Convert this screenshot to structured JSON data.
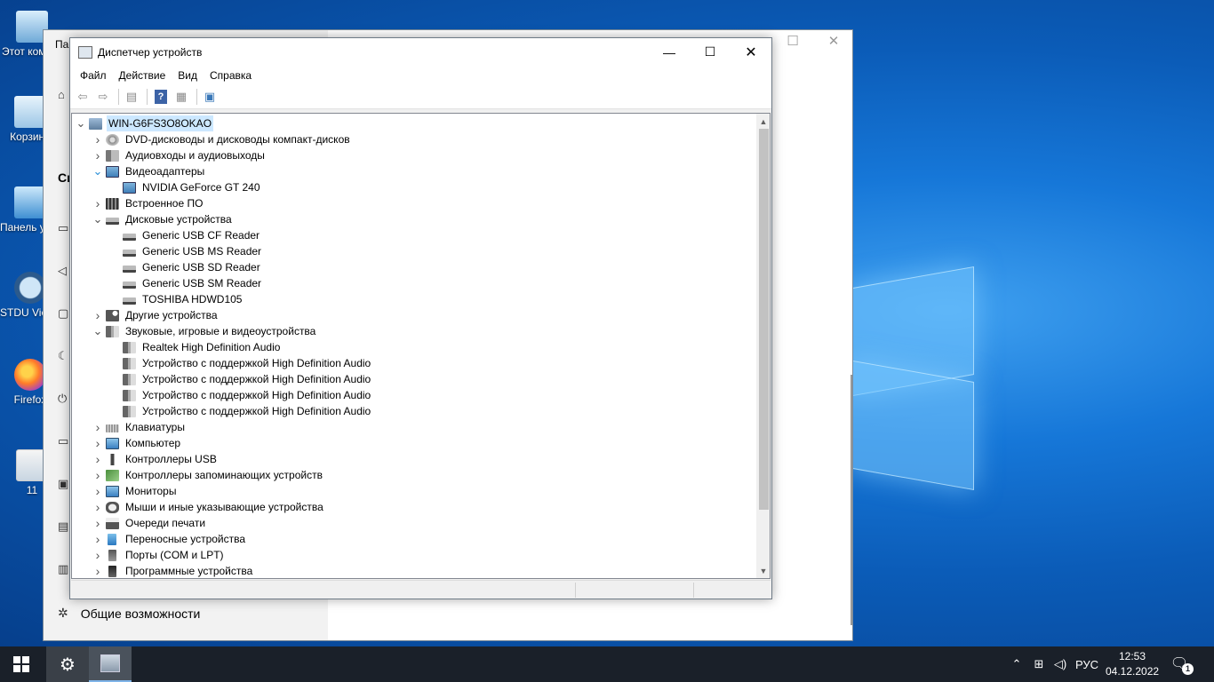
{
  "desktop": {
    "icons": [
      {
        "label": "Этот компьютер"
      },
      {
        "label": "Корзина"
      },
      {
        "label": "Панель управления"
      },
      {
        "label": "STDU Viewer"
      },
      {
        "label": "Firefox"
      },
      {
        "label": "11"
      }
    ]
  },
  "settings_window": {
    "title_fragment": "Па",
    "section_fragment": "Си",
    "accessibility_label": "Общие возможности"
  },
  "device_manager": {
    "title": "Диспетчер устройств",
    "menu": [
      "Файл",
      "Действие",
      "Вид",
      "Справка"
    ],
    "toolbar": [
      "back-icon",
      "forward-icon",
      "properties-view-icon",
      "help-icon",
      "action-pane-icon",
      "scan-hardware-icon"
    ],
    "tree": [
      {
        "level": 0,
        "label": "WIN-G6FS3O8OKAO",
        "expand": "open",
        "icon": "computer-icon"
      },
      {
        "level": 1,
        "label": "DVD-дисководы и дисководы компакт-дисков",
        "expand": "closed",
        "icon": "dvd-icon"
      },
      {
        "level": 1,
        "label": "Аудиовходы и аудиовыходы",
        "expand": "closed",
        "icon": "audio-io-icon"
      },
      {
        "level": 1,
        "label": "Видеоадаптеры",
        "expand": "open-hover",
        "icon": "video-adapter-icon"
      },
      {
        "level": 2,
        "label": "NVIDIA GeForce GT 240",
        "expand": "none",
        "icon": "video-adapter-icon"
      },
      {
        "level": 1,
        "label": "Встроенное ПО",
        "expand": "closed",
        "icon": "firmware-icon"
      },
      {
        "level": 1,
        "label": "Дисковые устройства",
        "expand": "open",
        "icon": "disk-icon"
      },
      {
        "level": 2,
        "label": "Generic USB CF Reader",
        "expand": "none",
        "icon": "disk-icon"
      },
      {
        "level": 2,
        "label": "Generic USB MS Reader",
        "expand": "none",
        "icon": "disk-icon"
      },
      {
        "level": 2,
        "label": "Generic USB SD Reader",
        "expand": "none",
        "icon": "disk-icon"
      },
      {
        "level": 2,
        "label": "Generic USB SM Reader",
        "expand": "none",
        "icon": "disk-icon"
      },
      {
        "level": 2,
        "label": "TOSHIBA HDWD105",
        "expand": "none",
        "icon": "disk-icon"
      },
      {
        "level": 1,
        "label": "Другие устройства",
        "expand": "closed",
        "icon": "other-devices-icon"
      },
      {
        "level": 1,
        "label": "Звуковые, игровые и видеоустройства",
        "expand": "open",
        "icon": "speaker-icon"
      },
      {
        "level": 2,
        "label": "Realtek High Definition Audio",
        "expand": "none",
        "icon": "speaker-icon"
      },
      {
        "level": 2,
        "label": "Устройство с поддержкой High Definition Audio",
        "expand": "none",
        "icon": "speaker-icon"
      },
      {
        "level": 2,
        "label": "Устройство с поддержкой High Definition Audio",
        "expand": "none",
        "icon": "speaker-icon"
      },
      {
        "level": 2,
        "label": "Устройство с поддержкой High Definition Audio",
        "expand": "none",
        "icon": "speaker-icon"
      },
      {
        "level": 2,
        "label": "Устройство с поддержкой High Definition Audio",
        "expand": "none",
        "icon": "speaker-icon"
      },
      {
        "level": 1,
        "label": "Клавиатуры",
        "expand": "closed",
        "icon": "keyboard-icon"
      },
      {
        "level": 1,
        "label": "Компьютер",
        "expand": "closed",
        "icon": "monitor-icon"
      },
      {
        "level": 1,
        "label": "Контроллеры USB",
        "expand": "closed",
        "icon": "usb-icon"
      },
      {
        "level": 1,
        "label": "Контроллеры запоминающих устройств",
        "expand": "closed",
        "icon": "storage-controller-icon"
      },
      {
        "level": 1,
        "label": "Мониторы",
        "expand": "closed",
        "icon": "monitor-icon"
      },
      {
        "level": 1,
        "label": "Мыши и иные указывающие устройства",
        "expand": "closed",
        "icon": "mouse-icon"
      },
      {
        "level": 1,
        "label": "Очереди печати",
        "expand": "closed",
        "icon": "printer-icon"
      },
      {
        "level": 1,
        "label": "Переносные устройства",
        "expand": "closed",
        "icon": "portable-device-icon"
      },
      {
        "level": 1,
        "label": "Порты (COM и LPT)",
        "expand": "closed",
        "icon": "port-icon"
      },
      {
        "level": 1,
        "label": "Программные устройства",
        "expand": "closed",
        "icon": "software-device-icon"
      }
    ]
  },
  "taskbar": {
    "language": "РУС",
    "time": "12:53",
    "date": "04.12.2022",
    "notification_count": "1"
  },
  "colors": {
    "selection": "#cce8ff",
    "taskbar": "#1a2029",
    "desktop": "#0b5cb8"
  }
}
